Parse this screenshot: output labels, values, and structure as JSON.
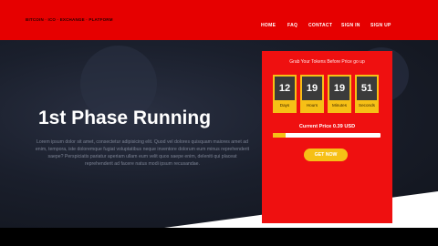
{
  "brand": {
    "tagline": "BITCOIN · ICO · EXCHANGE · PLATFORM"
  },
  "nav": {
    "items": [
      "HOME",
      "FAQ",
      "CONTACT",
      "SIGN IN",
      "SIGN UP"
    ]
  },
  "hero": {
    "title": "1st Phase Running",
    "text": "Lorem ipsum dolor sit amet, consectetur adipisicing elit. Quod vel dolores quisquam maiores amet ad enim, tempora, iste doloremque fugiat voluptatibus neque inventore dolorum eum minus reprehenderit saepe? Perspiciatis pariatur aperiam ullam eum velit quos saepe enim, deleniti qui placeat reprehenderit ad facere natus modi ipsum recusandae."
  },
  "countdown": {
    "heading": "Grab Your Tokens Before Price go up",
    "units": [
      {
        "value": "12",
        "label": "Days"
      },
      {
        "value": "19",
        "label": "Hours"
      },
      {
        "value": "19",
        "label": "Minutes"
      },
      {
        "value": "51",
        "label": "Seconds"
      }
    ],
    "price_label": "Current Price",
    "price_value": "0.39 USD",
    "progress_fraction": 0.12,
    "button_label": "GET NOW"
  },
  "colors": {
    "primary": "#e60000",
    "accent": "#f6c016",
    "dark": "#1a1f2c"
  }
}
